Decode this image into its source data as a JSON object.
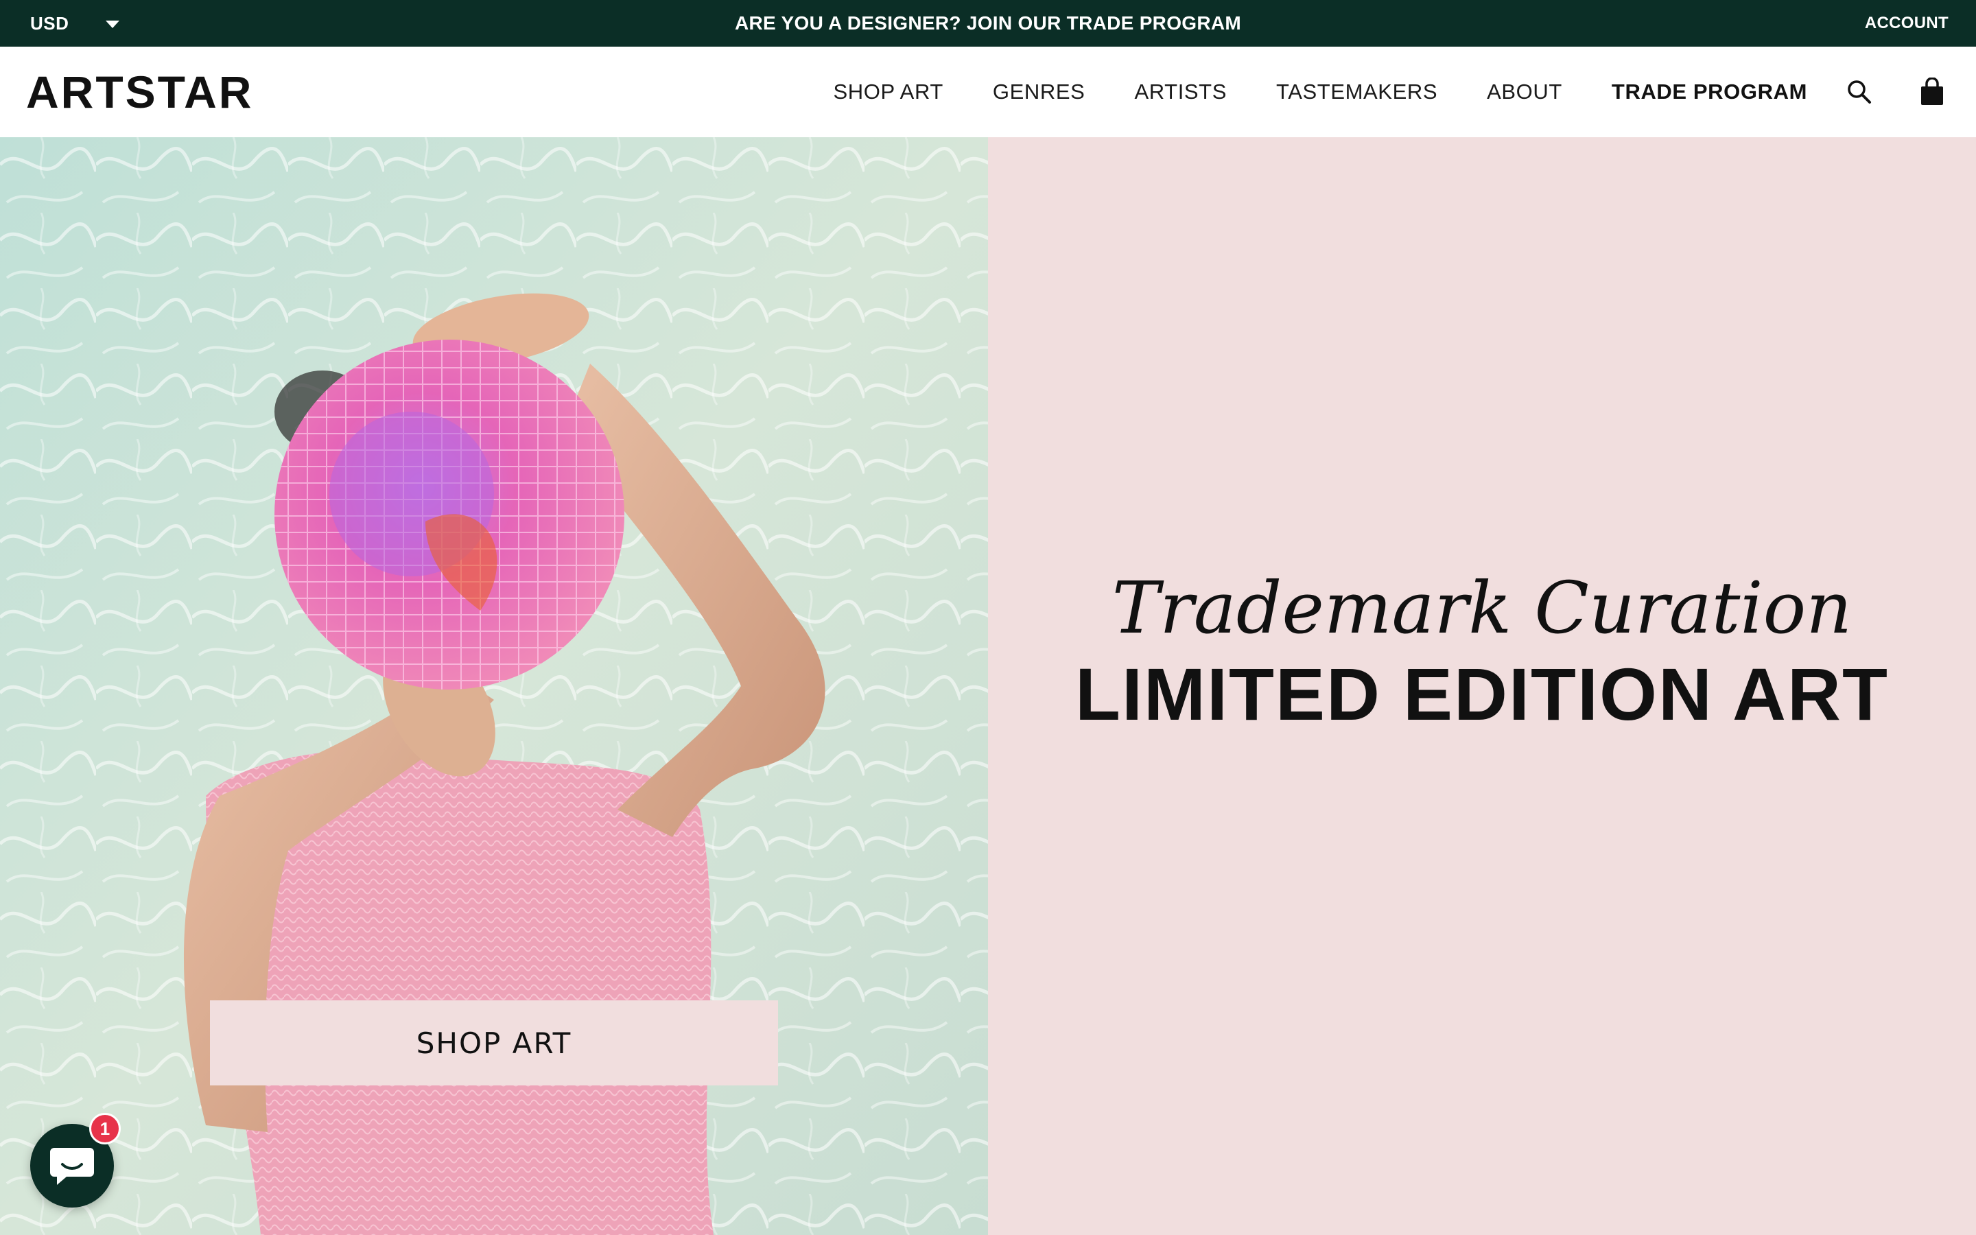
{
  "topbar": {
    "currency": "USD",
    "promo": "ARE YOU A DESIGNER? JOIN OUR TRADE PROGRAM",
    "account": "ACCOUNT"
  },
  "header": {
    "logo": "ARTSTAR",
    "nav": [
      {
        "label": "SHOP ART"
      },
      {
        "label": "GENRES"
      },
      {
        "label": "ARTISTS"
      },
      {
        "label": "TASTEMAKERS"
      },
      {
        "label": "ABOUT"
      },
      {
        "label": "TRADE PROGRAM"
      }
    ],
    "icons": [
      "search-icon",
      "cart-icon"
    ]
  },
  "hero": {
    "tagline": "Trademark Curation",
    "headline": "LIMITED EDITION ART",
    "cta": "SHOP ART"
  },
  "chat": {
    "badge": "1"
  },
  "colors": {
    "topbar": "#0b2e26",
    "hero_panel": "#f1dede",
    "badge": "#e7334a"
  }
}
